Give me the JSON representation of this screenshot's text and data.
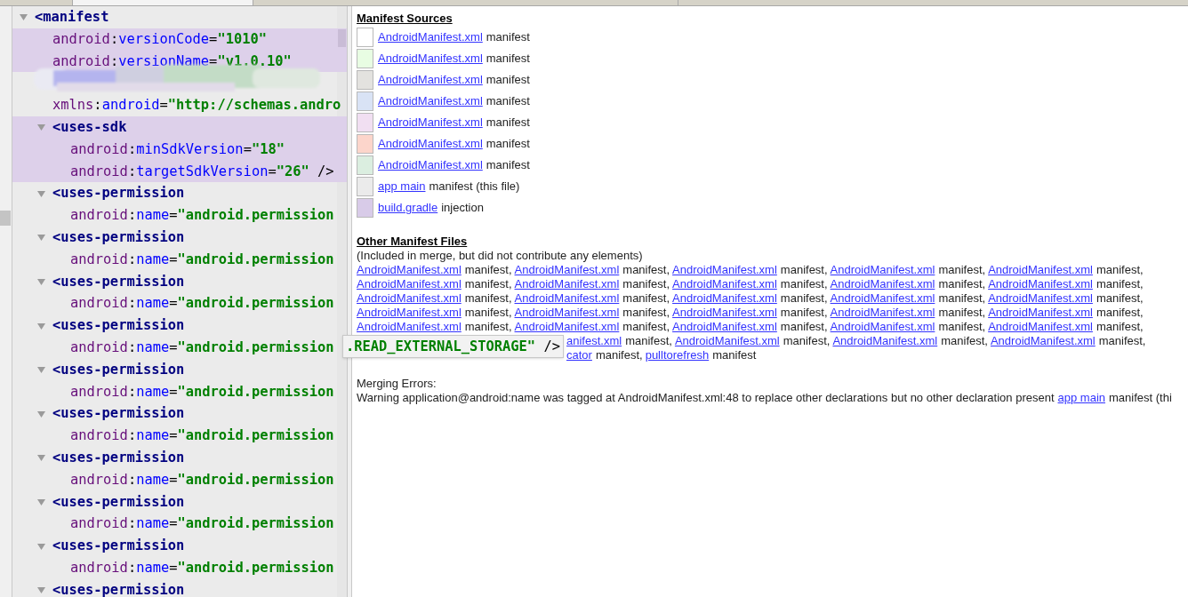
{
  "editor": {
    "root": {
      "tag": "<manifest",
      "expanded": true,
      "highlighted": false,
      "attributes": [
        {
          "kind": "attr",
          "highlighted": true,
          "tokens": [
            {
              "kind": "ns",
              "text": "android"
            },
            {
              "kind": "punct",
              "text": ":"
            },
            {
              "kind": "name",
              "text": "versionCode"
            },
            {
              "kind": "punct",
              "text": "="
            },
            {
              "kind": "value",
              "text": "\"1010\""
            }
          ]
        },
        {
          "kind": "attr",
          "highlighted": true,
          "tokens": [
            {
              "kind": "ns",
              "text": "android"
            },
            {
              "kind": "punct",
              "text": ":"
            },
            {
              "kind": "name",
              "text": "versionName"
            },
            {
              "kind": "punct",
              "text": "="
            },
            {
              "kind": "value",
              "text": "\"v1.0.10\""
            }
          ]
        },
        {
          "kind": "redacted",
          "highlighted": false
        },
        {
          "kind": "attr",
          "highlighted": false,
          "tokens": [
            {
              "kind": "ns",
              "text": "xmlns"
            },
            {
              "kind": "punct",
              "text": ":"
            },
            {
              "kind": "name",
              "text": "android"
            },
            {
              "kind": "punct",
              "text": "="
            },
            {
              "kind": "value",
              "text": "\"http://schemas.andro"
            }
          ]
        }
      ],
      "children": [
        {
          "tag": "<uses-sdk",
          "expanded": true,
          "highlighted": true,
          "attributes": [
            {
              "kind": "attr",
              "highlighted": true,
              "tokens": [
                {
                  "kind": "ns",
                  "text": "android"
                },
                {
                  "kind": "punct",
                  "text": ":"
                },
                {
                  "kind": "name",
                  "text": "minSdkVersion"
                },
                {
                  "kind": "punct",
                  "text": "="
                },
                {
                  "kind": "value",
                  "text": "\"18\""
                }
              ]
            },
            {
              "kind": "attr",
              "highlighted": true,
              "tokens": [
                {
                  "kind": "ns",
                  "text": "android"
                },
                {
                  "kind": "punct",
                  "text": ":"
                },
                {
                  "kind": "name",
                  "text": "targetSdkVersion"
                },
                {
                  "kind": "punct",
                  "text": "="
                },
                {
                  "kind": "value",
                  "text": "\"26\""
                },
                {
                  "kind": "punct",
                  "text": " />"
                }
              ]
            }
          ]
        },
        {
          "tag": "<uses-permission",
          "expanded": true,
          "highlighted": false,
          "attributes": [
            {
              "kind": "attr",
              "highlighted": false,
              "tokens": [
                {
                  "kind": "ns",
                  "text": "android"
                },
                {
                  "kind": "punct",
                  "text": ":"
                },
                {
                  "kind": "name",
                  "text": "name"
                },
                {
                  "kind": "punct",
                  "text": "="
                },
                {
                  "kind": "value",
                  "text": "\"android.permission"
                }
              ]
            }
          ]
        },
        {
          "tag": "<uses-permission",
          "expanded": true,
          "highlighted": false,
          "attributes": [
            {
              "kind": "attr",
              "highlighted": false,
              "tokens": [
                {
                  "kind": "ns",
                  "text": "android"
                },
                {
                  "kind": "punct",
                  "text": ":"
                },
                {
                  "kind": "name",
                  "text": "name"
                },
                {
                  "kind": "punct",
                  "text": "="
                },
                {
                  "kind": "value",
                  "text": "\"android.permission"
                }
              ]
            }
          ]
        },
        {
          "tag": "<uses-permission",
          "expanded": true,
          "highlighted": false,
          "attributes": [
            {
              "kind": "attr",
              "highlighted": false,
              "tokens": [
                {
                  "kind": "ns",
                  "text": "android"
                },
                {
                  "kind": "punct",
                  "text": ":"
                },
                {
                  "kind": "name",
                  "text": "name"
                },
                {
                  "kind": "punct",
                  "text": "="
                },
                {
                  "kind": "value",
                  "text": "\"android.permission"
                }
              ]
            }
          ]
        },
        {
          "tag": "<uses-permission",
          "expanded": true,
          "highlighted": false,
          "attributes": [
            {
              "kind": "attr",
              "highlighted": false,
              "tokens": [
                {
                  "kind": "ns",
                  "text": "android"
                },
                {
                  "kind": "punct",
                  "text": ":"
                },
                {
                  "kind": "name",
                  "text": "name"
                },
                {
                  "kind": "punct",
                  "text": "="
                },
                {
                  "kind": "value",
                  "text": "\"android.permission"
                }
              ],
              "tooltip": [
                {
                  "kind": "value",
                  "text": ".READ_EXTERNAL_STORAGE\""
                },
                {
                  "kind": "punct",
                  "text": " />"
                }
              ]
            }
          ]
        },
        {
          "tag": "<uses-permission",
          "expanded": true,
          "highlighted": false,
          "attributes": [
            {
              "kind": "attr",
              "highlighted": false,
              "tokens": [
                {
                  "kind": "ns",
                  "text": "android"
                },
                {
                  "kind": "punct",
                  "text": ":"
                },
                {
                  "kind": "name",
                  "text": "name"
                },
                {
                  "kind": "punct",
                  "text": "="
                },
                {
                  "kind": "value",
                  "text": "\"android.permission"
                }
              ]
            }
          ]
        },
        {
          "tag": "<uses-permission",
          "expanded": true,
          "highlighted": false,
          "attributes": [
            {
              "kind": "attr",
              "highlighted": false,
              "tokens": [
                {
                  "kind": "ns",
                  "text": "android"
                },
                {
                  "kind": "punct",
                  "text": ":"
                },
                {
                  "kind": "name",
                  "text": "name"
                },
                {
                  "kind": "punct",
                  "text": "="
                },
                {
                  "kind": "value",
                  "text": "\"android.permission"
                }
              ]
            }
          ]
        },
        {
          "tag": "<uses-permission",
          "expanded": true,
          "highlighted": false,
          "attributes": [
            {
              "kind": "attr",
              "highlighted": false,
              "tokens": [
                {
                  "kind": "ns",
                  "text": "android"
                },
                {
                  "kind": "punct",
                  "text": ":"
                },
                {
                  "kind": "name",
                  "text": "name"
                },
                {
                  "kind": "punct",
                  "text": "="
                },
                {
                  "kind": "value",
                  "text": "\"android.permission"
                }
              ]
            }
          ]
        },
        {
          "tag": "<uses-permission",
          "expanded": true,
          "highlighted": false,
          "attributes": [
            {
              "kind": "attr",
              "highlighted": false,
              "tokens": [
                {
                  "kind": "ns",
                  "text": "android"
                },
                {
                  "kind": "punct",
                  "text": ":"
                },
                {
                  "kind": "name",
                  "text": "name"
                },
                {
                  "kind": "punct",
                  "text": "="
                },
                {
                  "kind": "value",
                  "text": "\"android.permission"
                }
              ]
            }
          ]
        },
        {
          "tag": "<uses-permission",
          "expanded": true,
          "highlighted": false,
          "attributes": [
            {
              "kind": "attr",
              "highlighted": false,
              "tokens": [
                {
                  "kind": "ns",
                  "text": "android"
                },
                {
                  "kind": "punct",
                  "text": ":"
                },
                {
                  "kind": "name",
                  "text": "name"
                },
                {
                  "kind": "punct",
                  "text": "="
                },
                {
                  "kind": "value",
                  "text": "\"android.permission"
                }
              ]
            }
          ]
        },
        {
          "tag": "<uses-permission",
          "expanded": true,
          "highlighted": false
        }
      ]
    }
  },
  "sources": {
    "title": "Manifest Sources",
    "items": [
      {
        "color": "#ffffff",
        "link": "AndroidManifest.xml",
        "text": "manifest"
      },
      {
        "color": "#e8fde3",
        "link": "AndroidManifest.xml",
        "text": "manifest"
      },
      {
        "color": "#e3e2df",
        "link": "AndroidManifest.xml",
        "text": "manifest"
      },
      {
        "color": "#d9e3f5",
        "link": "AndroidManifest.xml",
        "text": "manifest"
      },
      {
        "color": "#f1dff2",
        "link": "AndroidManifest.xml",
        "text": "manifest"
      },
      {
        "color": "#fcd5cb",
        "link": "AndroidManifest.xml",
        "text": "manifest"
      },
      {
        "color": "#dbeee0",
        "link": "AndroidManifest.xml",
        "text": "manifest"
      },
      {
        "color": "#ebebeb",
        "link": "app main",
        "text": "manifest (this file)"
      },
      {
        "color": "#d8cbe8",
        "link": "build.gradle",
        "text": "injection"
      }
    ]
  },
  "other_files": {
    "title": "Other Manifest Files",
    "note": "(Included in merge, but did not contribute any elements)",
    "lines": [
      {
        "covered": false,
        "items": [
          {
            "link": "AndroidManifest.xml",
            "text": "manifest,"
          },
          {
            "link": "AndroidManifest.xml",
            "text": "manifest,"
          },
          {
            "link": "AndroidManifest.xml",
            "text": "manifest,"
          },
          {
            "link": "AndroidManifest.xml",
            "text": "manifest,"
          },
          {
            "link": "AndroidManifest.xml",
            "text": "manifest,"
          }
        ]
      },
      {
        "covered": false,
        "items": [
          {
            "link": "AndroidManifest.xml",
            "text": "manifest,"
          },
          {
            "link": "AndroidManifest.xml",
            "text": "manifest,"
          },
          {
            "link": "AndroidManifest.xml",
            "text": "manifest,"
          },
          {
            "link": "AndroidManifest.xml",
            "text": "manifest,"
          },
          {
            "link": "AndroidManifest.xml",
            "text": "manifest,"
          }
        ]
      },
      {
        "covered": false,
        "items": [
          {
            "link": "AndroidManifest.xml",
            "text": "manifest,"
          },
          {
            "link": "AndroidManifest.xml",
            "text": "manifest,"
          },
          {
            "link": "AndroidManifest.xml",
            "text": "manifest,"
          },
          {
            "link": "AndroidManifest.xml",
            "text": "manifest,"
          },
          {
            "link": "AndroidManifest.xml",
            "text": "manifest,"
          }
        ]
      },
      {
        "covered": false,
        "items": [
          {
            "link": "AndroidManifest.xml",
            "text": "manifest,"
          },
          {
            "link": "AndroidManifest.xml",
            "text": "manifest,"
          },
          {
            "link": "AndroidManifest.xml",
            "text": "manifest,"
          },
          {
            "link": "AndroidManifest.xml",
            "text": "manifest,"
          },
          {
            "link": "AndroidManifest.xml",
            "text": "manifest,"
          }
        ]
      },
      {
        "covered": false,
        "items": [
          {
            "link": "AndroidManifest.xml",
            "text": "manifest,"
          },
          {
            "link": "AndroidManifest.xml",
            "text": "manifest,"
          },
          {
            "link": "AndroidManifest.xml",
            "text": "manifest,"
          },
          {
            "link": "AndroidManifest.xml",
            "text": "manifest,"
          },
          {
            "link": "AndroidManifest.xml",
            "text": "manifest,"
          }
        ]
      },
      {
        "covered": true,
        "items": [
          {
            "link": "anifest.xml",
            "text": "manifest,"
          },
          {
            "link": "AndroidManifest.xml",
            "text": "manifest,"
          },
          {
            "link": "AndroidManifest.xml",
            "text": "manifest,"
          },
          {
            "link": "AndroidManifest.xml",
            "text": "manifest,"
          }
        ]
      },
      {
        "covered": true,
        "items": [
          {
            "link": "cator",
            "text": "manifest,"
          },
          {
            "link": "pulltorefresh",
            "text": "manifest"
          }
        ]
      }
    ]
  },
  "errors": {
    "title": "Merging Errors:",
    "lines": [
      {
        "text": "Warning application@android:name was tagged at AndroidManifest.xml:48 to replace other declarations but no other declaration present",
        "link": "app main",
        "after": "manifest (thi"
      }
    ]
  }
}
